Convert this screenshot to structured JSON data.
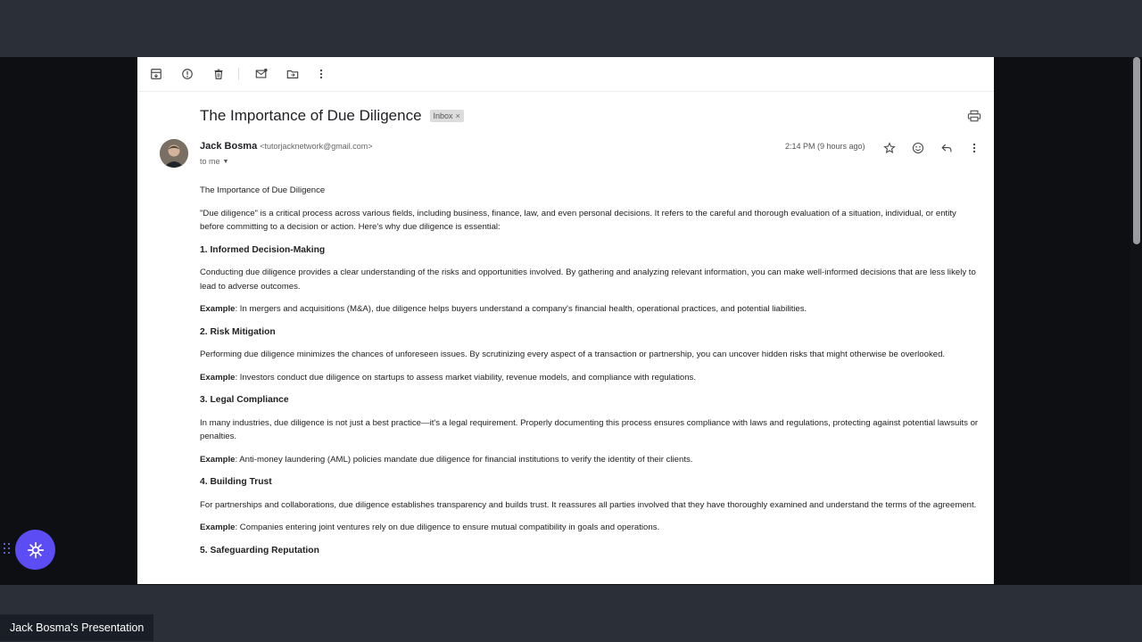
{
  "email": {
    "subject": "The Importance of Due Diligence",
    "label_badge": "Inbox",
    "badge_close": "×",
    "sender_name": "Jack Bosma",
    "sender_email": "<tutorjacknetwork@gmail.com>",
    "recipient": "to me",
    "timestamp": "2:14 PM (9 hours ago)",
    "body": {
      "intro_title": "The Importance of Due Diligence",
      "intro_text": "\"Due diligence\" is a critical process across various fields, including business, finance, law, and even personal decisions. It refers to the careful and thorough evaluation of a situation, individual, or entity before committing to a decision or action. Here's why due diligence is essential:",
      "example_label": "Example",
      "sections": [
        {
          "heading": "1. Informed Decision-Making",
          "text": "Conducting due diligence provides a clear understanding of the risks and opportunities involved. By gathering and analyzing relevant information, you can make well-informed decisions that are less likely to lead to adverse outcomes.",
          "example": ": In mergers and acquisitions (M&A), due diligence helps buyers understand a company's financial health, operational practices, and potential liabilities."
        },
        {
          "heading": "2. Risk Mitigation",
          "text": "Performing due diligence minimizes the chances of unforeseen issues. By scrutinizing every aspect of a transaction or partnership, you can uncover hidden risks that might otherwise be overlooked.",
          "example": ": Investors conduct due diligence on startups to assess market viability, revenue models, and compliance with regulations."
        },
        {
          "heading": "3. Legal Compliance",
          "text": "In many industries, due diligence is not just a best practice—it's a legal requirement. Properly documenting this process ensures compliance with laws and regulations, protecting against potential lawsuits or penalties.",
          "example": ": Anti-money laundering (AML) policies mandate due diligence for financial institutions to verify the identity of their clients."
        },
        {
          "heading": "4. Building Trust",
          "text": "For partnerships and collaborations, due diligence establishes transparency and builds trust. It reassures all parties involved that they have thoroughly examined and understand the terms of the agreement.",
          "example": ": Companies entering joint ventures rely on due diligence to ensure mutual compatibility in goals and operations."
        },
        {
          "heading": "5. Safeguarding Reputation"
        }
      ]
    }
  },
  "toolbar_icons": [
    "archive-icon",
    "report-spam-icon",
    "delete-icon",
    "mark-unread-icon",
    "move-to-icon",
    "more-vert-icon"
  ],
  "header_icons": [
    "star-icon",
    "emoji-icon",
    "reply-icon",
    "more-vert-icon",
    "print-icon"
  ],
  "presentation": {
    "label": "Jack Bosma's Presentation"
  },
  "colors": {
    "app_bar": "#2a2f38",
    "stage": "#0e0f12",
    "presentation_button": "#5b4cf3"
  }
}
